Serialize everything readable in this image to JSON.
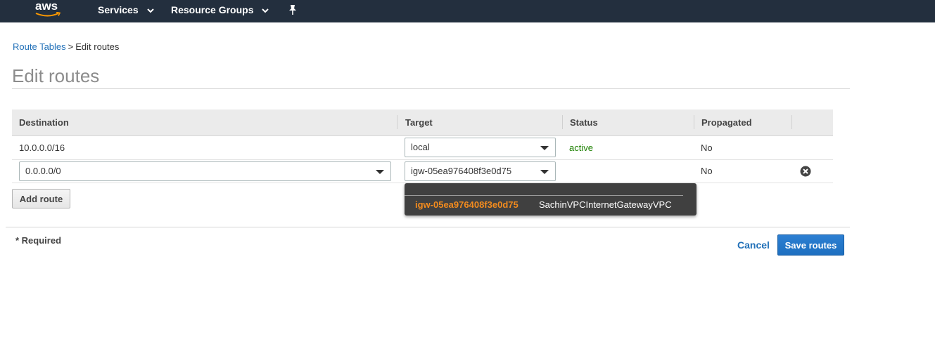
{
  "nav": {
    "logo_text": "aws",
    "services_label": "Services",
    "resource_groups_label": "Resource Groups",
    "pin_icon": "pin-icon",
    "brand_color": "#232f3e",
    "smile_color": "#ff9900"
  },
  "breadcrumb": {
    "parent": "Route Tables",
    "separator": ">",
    "current": "Edit routes"
  },
  "page_title": "Edit routes",
  "table": {
    "headers": [
      "Destination",
      "Target",
      "Status",
      "Propagated"
    ],
    "rows": [
      {
        "destination": "10.0.0.0/16",
        "target": "local",
        "status": "active",
        "propagated": "No"
      },
      {
        "destination": "0.0.0.0/0",
        "target": "igw-05ea976408f3e0d75",
        "status": "",
        "propagated": "No"
      }
    ]
  },
  "add_route_label": "Add route",
  "dropdown": {
    "option_id": "igw-05ea976408f3e0d75",
    "option_name": "SachinVPCInternetGatewayVPC"
  },
  "required_note": "* Required",
  "cancel_label": "Cancel",
  "save_label": "Save routes",
  "colors": {
    "link": "#2170b8",
    "status_active": "#1d8102",
    "primary_button": "#1d6fc0",
    "dropdown_highlight": "#f28b1e"
  }
}
